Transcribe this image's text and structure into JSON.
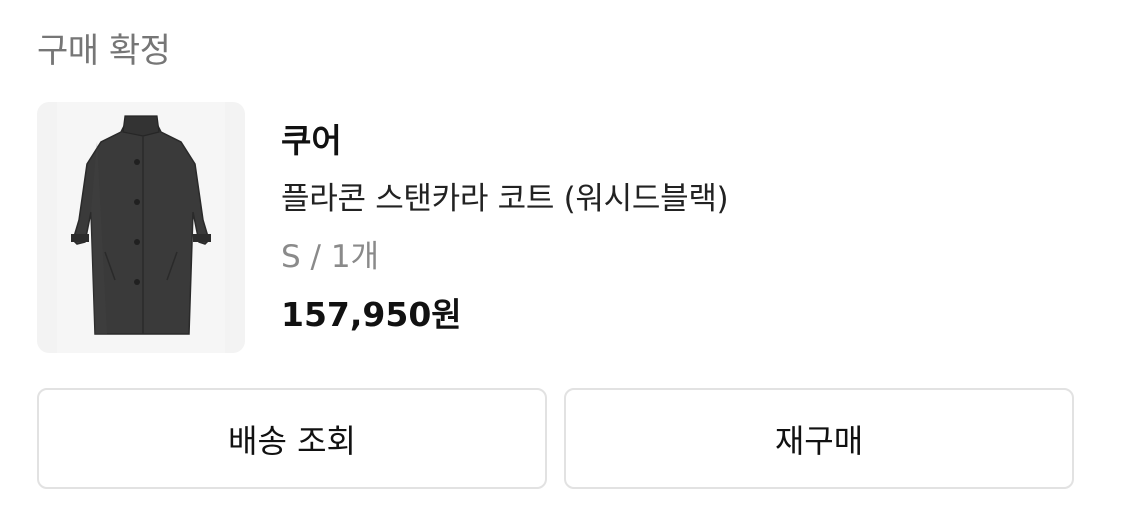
{
  "order": {
    "status": "구매 확정"
  },
  "product": {
    "image_icon": "coat-image",
    "brand": "쿠어",
    "name": "플라콘 스탠카라 코트 (워시드블랙)",
    "option": "S / 1개",
    "price": "157,950원"
  },
  "actions": {
    "track_label": "배송 조회",
    "rebuy_label": "재구매"
  }
}
